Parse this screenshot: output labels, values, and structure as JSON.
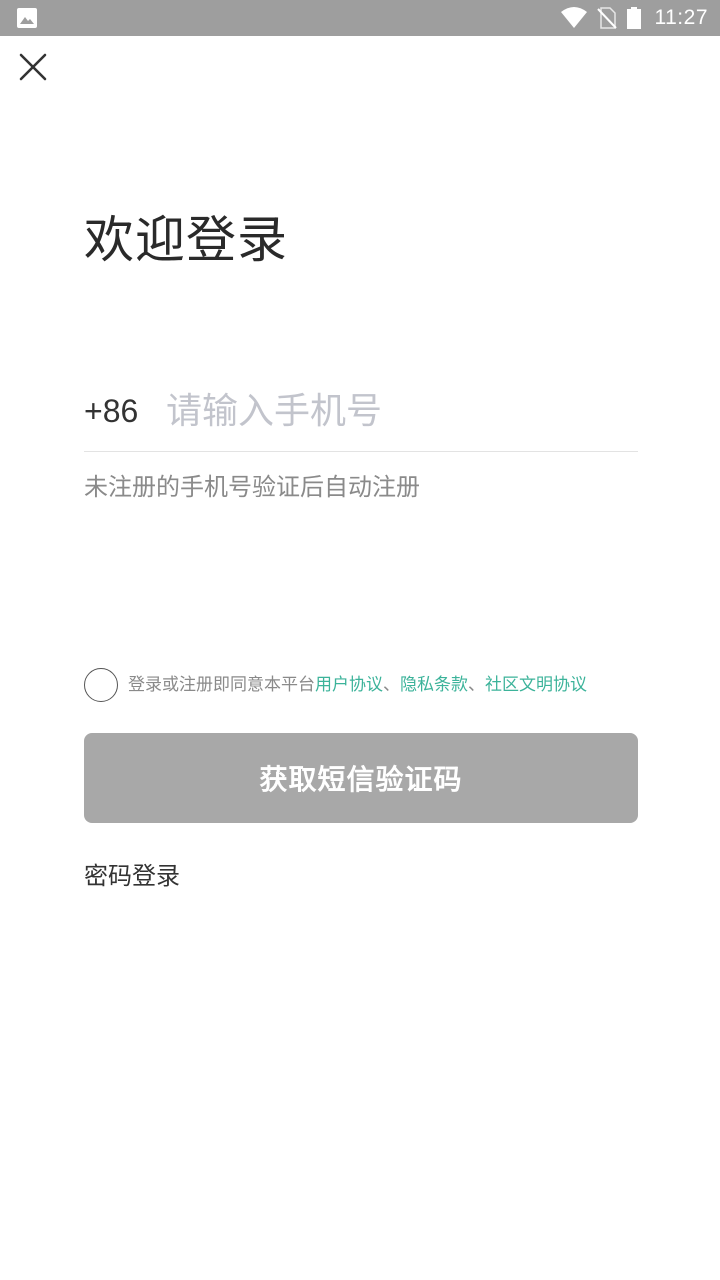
{
  "status_bar": {
    "time": "11:27",
    "left_icon": "image-icon",
    "icons": [
      "wifi-icon",
      "no-sim-icon",
      "battery-icon"
    ],
    "background": "#9e9e9e"
  },
  "header": {
    "close_icon": "close-icon"
  },
  "title": "欢迎登录",
  "phone": {
    "country_code": "+86",
    "value": "",
    "placeholder": "请输入手机号"
  },
  "hint": "未注册的手机号验证后自动注册",
  "agreement": {
    "prefix": "登录或注册即同意本平台",
    "user_agreement": "用户协议",
    "sep1": "、",
    "privacy": "隐私条款",
    "sep2": "、",
    "community": "社区文明协议",
    "link_color": "#3cb39a"
  },
  "sms_button": {
    "label": "获取短信验证码",
    "color": "#a8a8a8"
  },
  "password_login": "密码登录"
}
